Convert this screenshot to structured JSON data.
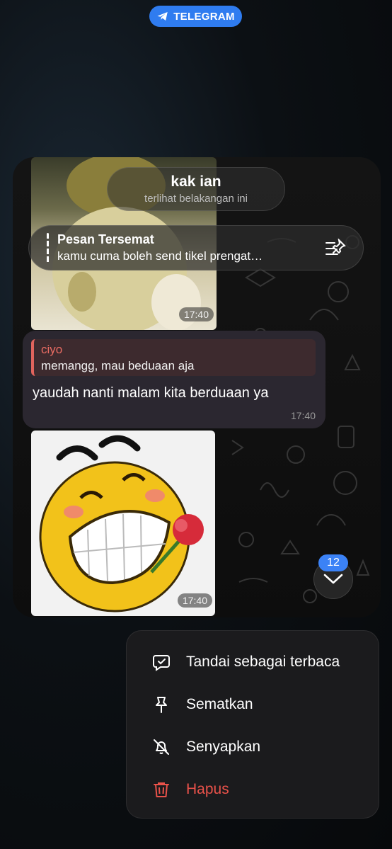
{
  "app_badge": {
    "label": "TELEGRAM",
    "icon": "telegram-icon",
    "color": "#2f7cf0"
  },
  "chat": {
    "title": "kak ian",
    "subtitle": "terlihat belakangan ini"
  },
  "pinned": {
    "title": "Pesan Tersemat",
    "text": "kamu cuma boleh send tikel prengat…",
    "icon": "pinned-list-icon"
  },
  "messages": {
    "photo_top_time": "17:40",
    "reply": {
      "author": "ciyo",
      "text": "memangg, mau beduaan aja",
      "author_color": "#e0645d"
    },
    "text": "yaudah nanti malam kita berduaan ya",
    "text_time": "17:40",
    "sticker_time": "17:40"
  },
  "scroll_down": {
    "unread_count": "12",
    "icon": "chevron-down-icon",
    "badge_color": "#3b82f6"
  },
  "menu": {
    "items": [
      {
        "label": "Tandai sebagai terbaca",
        "icon": "mark-read-icon"
      },
      {
        "label": "Sematkan",
        "icon": "pin-icon"
      },
      {
        "label": "Senyapkan",
        "icon": "bell-off-icon"
      },
      {
        "label": "Hapus",
        "icon": "trash-icon",
        "color": "#e9524a"
      }
    ]
  }
}
